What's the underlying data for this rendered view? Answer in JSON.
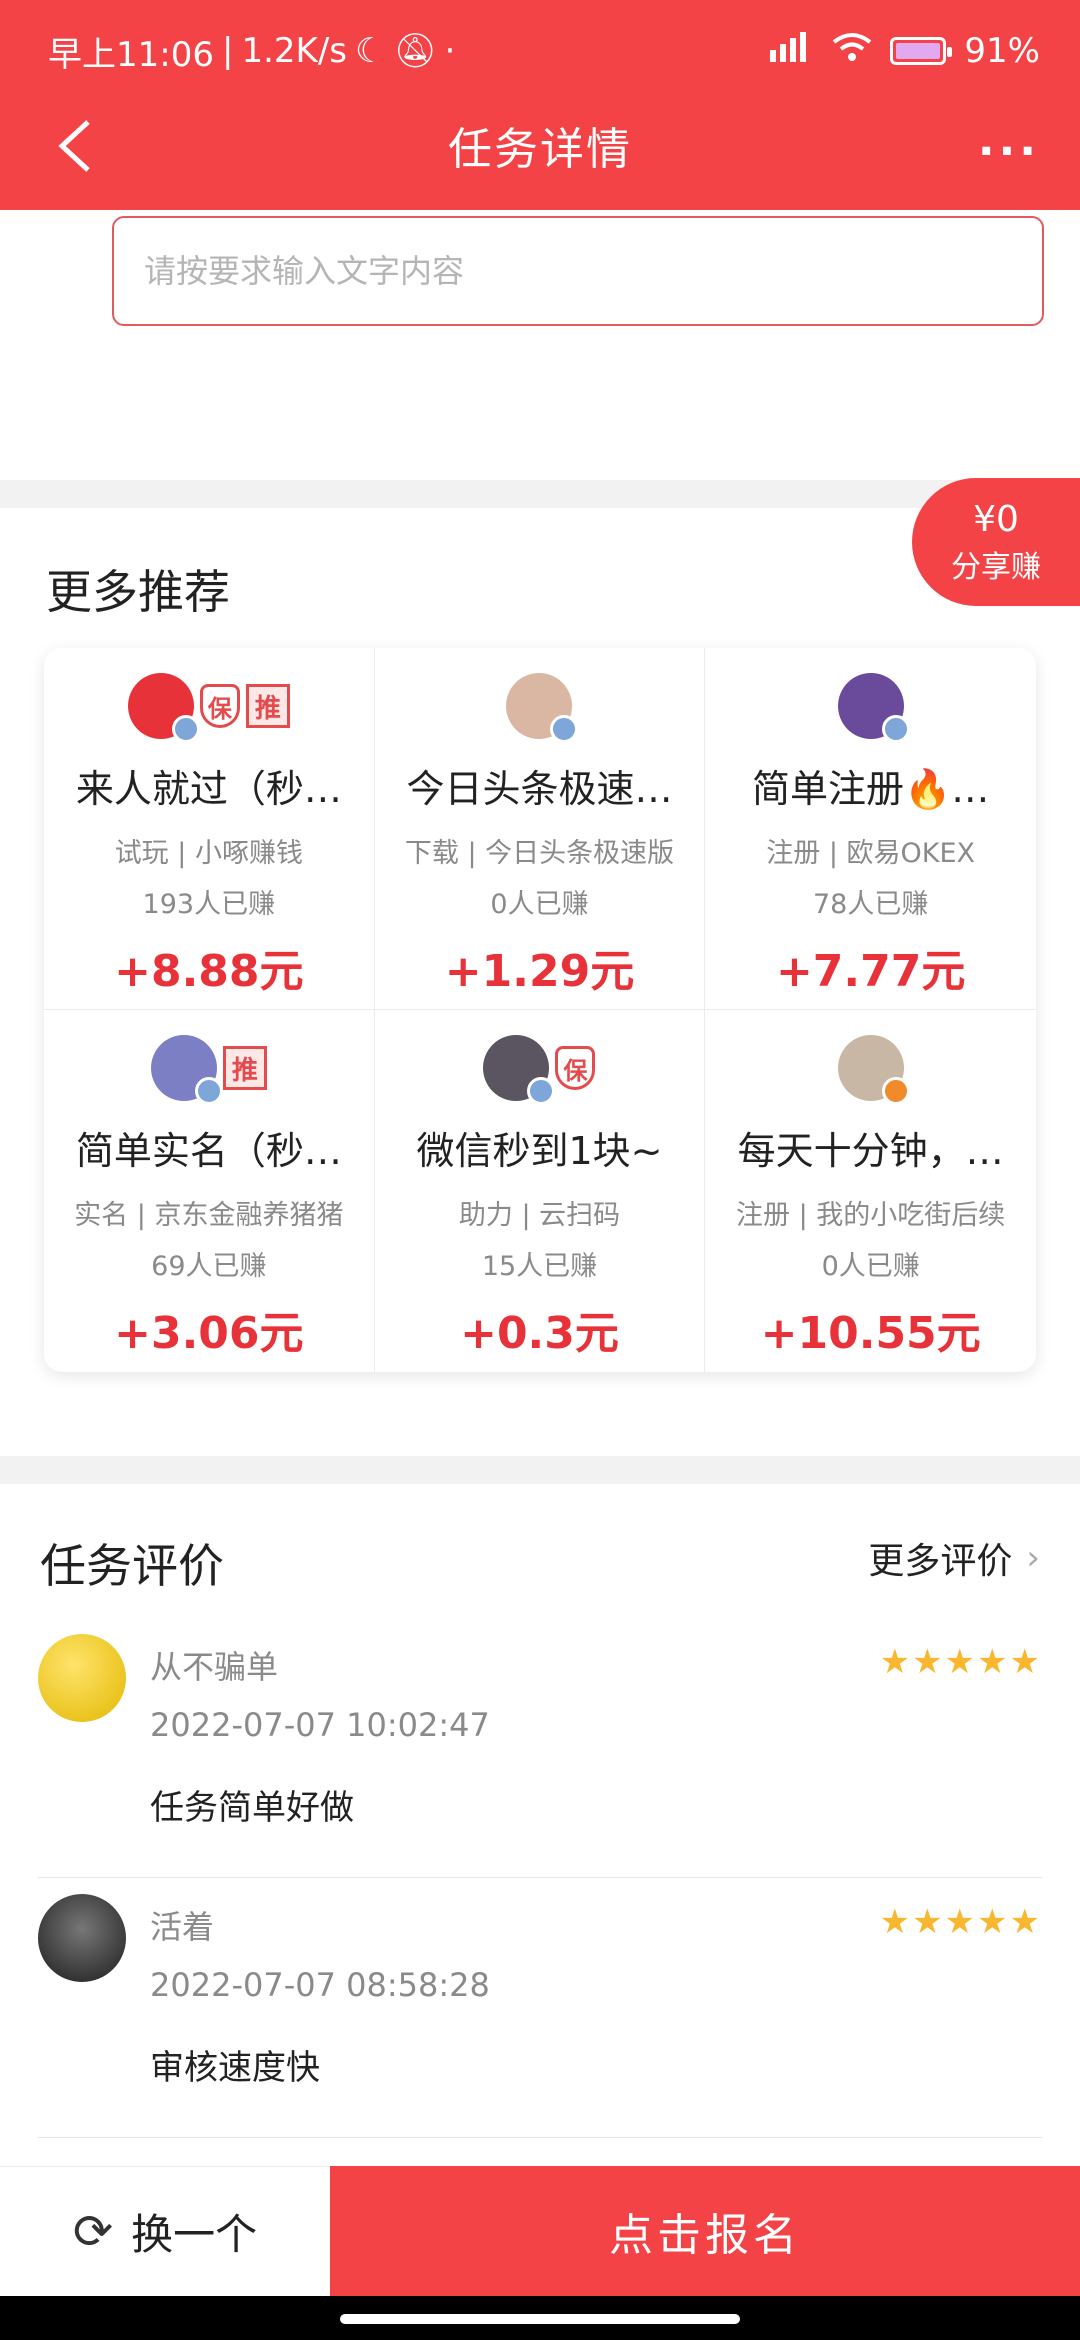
{
  "status": {
    "time": "早上11:06",
    "speed": "1.2K/s",
    "battery": "91%"
  },
  "header": {
    "title": "任务详情",
    "more": "···"
  },
  "input": {
    "placeholder": "请按要求输入文字内容"
  },
  "share": {
    "amount": "¥0",
    "label": "分享赚"
  },
  "recommend": {
    "title": "更多推荐",
    "items": [
      {
        "name": "来人就过（秒…",
        "category": "试玩 | 小啄赚钱",
        "count": "193人已赚",
        "reward": "+8.88元",
        "shield": "保",
        "tui": "推",
        "avatar_color": "#e8323a"
      },
      {
        "name": "今日头条极速…",
        "category": "下载 | 今日头条极速版",
        "count": "0人已赚",
        "reward": "+1.29元",
        "avatar_color": "#d9b7a3"
      },
      {
        "name": "简单注册🔥…",
        "category": "注册 | 欧易OKEX",
        "count": "78人已赚",
        "reward": "+7.77元",
        "avatar_color": "#6a4a9a"
      },
      {
        "name": "简单实名（秒…",
        "category": "实名 | 京东金融养猪猪",
        "count": "69人已赚",
        "reward": "+3.06元",
        "tui": "推",
        "avatar_color": "#7d7fc4"
      },
      {
        "name": "微信秒到1块~",
        "category": "助力 | 云扫码",
        "count": "15人已赚",
        "reward": "+0.3元",
        "shield": "保",
        "avatar_color": "#5a5560"
      },
      {
        "name": "每天十分钟，…",
        "category": "注册 | 我的小吃街后续",
        "count": "0人已赚",
        "reward": "+10.55元",
        "avatar_color": "#c9b7a6"
      }
    ]
  },
  "reviews": {
    "title": "任务评价",
    "more": "更多评价",
    "items": [
      {
        "user": "从不骗单",
        "time": "2022-07-07 10:02:47",
        "text": "任务简单好做",
        "stars": "★★★★★"
      },
      {
        "user": "活着",
        "time": "2022-07-07 08:58:28",
        "text": "审核速度快",
        "stars": "★★★★★"
      }
    ]
  },
  "bottom": {
    "swap_label": "换一个",
    "apply_label": "点击报名"
  }
}
